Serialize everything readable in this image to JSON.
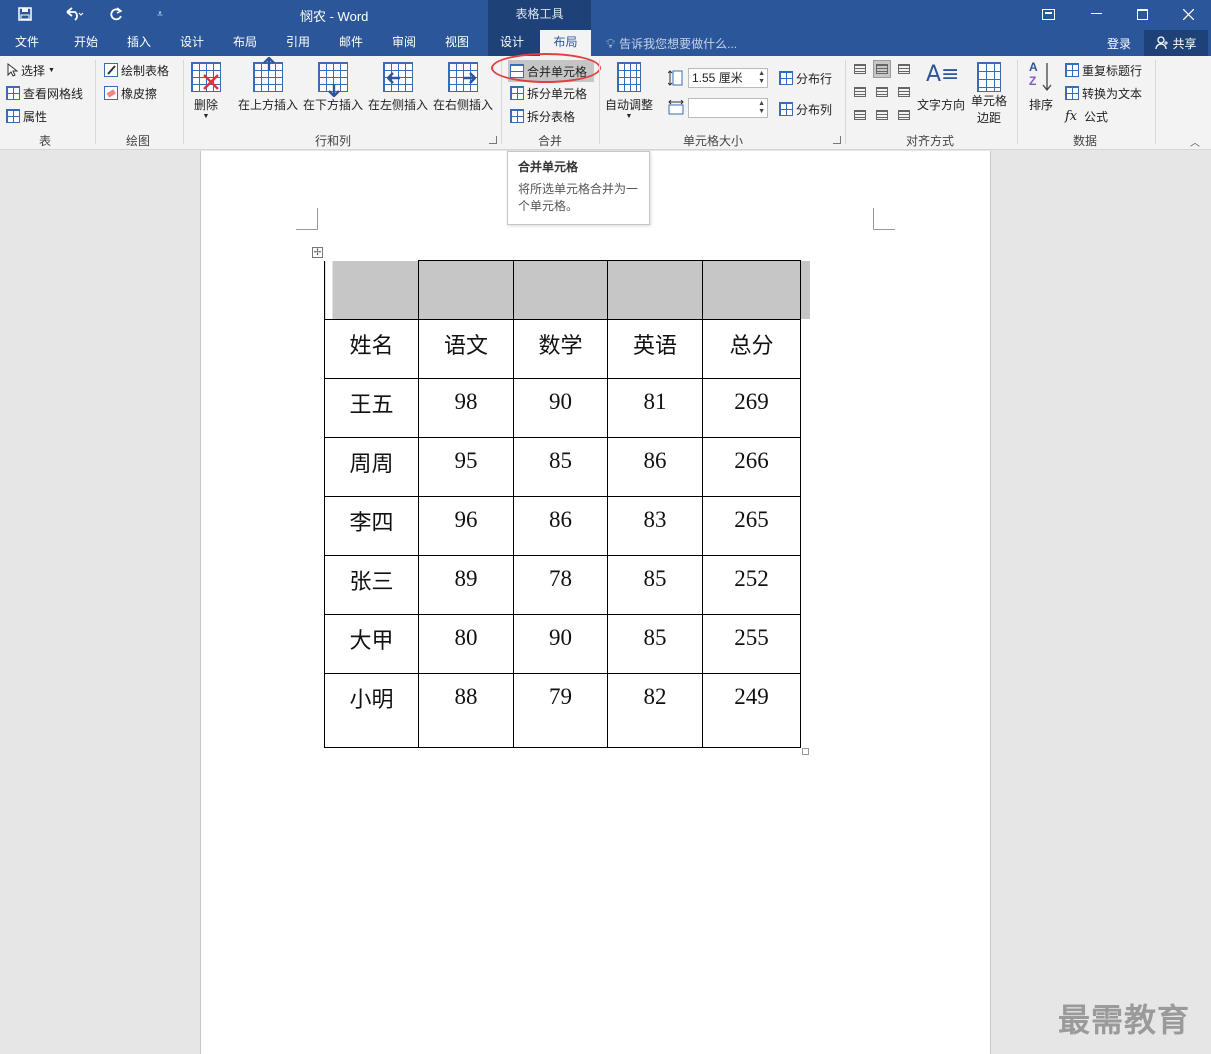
{
  "titlebar": {
    "save_icon": "save-icon",
    "undo_icon": "undo-icon",
    "redo_icon": "redo-icon",
    "customize_icon": "customize-qat-icon",
    "document_title": "悯农 - Word",
    "context_header": "表格工具"
  },
  "tabs": {
    "file": "文件",
    "home": "开始",
    "insert": "插入",
    "design": "设计",
    "layout": "布局",
    "references": "引用",
    "mailings": "邮件",
    "review": "审阅",
    "view": "视图",
    "table_design": "设计",
    "table_layout": "布局",
    "tell_me": "告诉我您想要做什么...",
    "sign_in": "登录",
    "share": "共享"
  },
  "ribbon": {
    "table_group": {
      "label": "表",
      "select": "选择",
      "view_gridlines": "查看网格线",
      "properties": "属性"
    },
    "draw_group": {
      "label": "绘图",
      "draw_table": "绘制表格",
      "eraser": "橡皮擦"
    },
    "rows_cols_group": {
      "label": "行和列",
      "delete": "删除",
      "insert_above": "在上方插入",
      "insert_below": "在下方插入",
      "insert_left": "在左侧插入",
      "insert_right": "在右侧插入"
    },
    "merge_group": {
      "label": "合并",
      "merge_cells": "合并单元格",
      "split_cells": "拆分单元格",
      "split_table": "拆分表格"
    },
    "cell_size_group": {
      "label": "单元格大小",
      "autofit": "自动调整",
      "height_value": "1.55 厘米",
      "width_value": "",
      "distribute_rows": "分布行",
      "distribute_cols": "分布列"
    },
    "alignment_group": {
      "label": "对齐方式",
      "text_direction": "文字方向",
      "cell_margins_line1": "单元格",
      "cell_margins_line2": "边距"
    },
    "data_group": {
      "label": "数据",
      "sort": "排序",
      "repeat_header": "重复标题行",
      "convert_to_text": "转换为文本",
      "formula": "公式"
    }
  },
  "tooltip": {
    "title": "合并单元格",
    "description_line1": "将所选单元格合并为一",
    "description_line2": "个单元格。"
  },
  "table": {
    "header": [
      "姓名",
      "语文",
      "数学",
      "英语",
      "总分"
    ],
    "rows": [
      [
        "王五",
        "98",
        "90",
        "81",
        "269"
      ],
      [
        "周周",
        "95",
        "85",
        "86",
        "266"
      ],
      [
        "李四",
        "96",
        "86",
        "83",
        "265"
      ],
      [
        "张三",
        "89",
        "78",
        "85",
        "252"
      ],
      [
        "大甲",
        "80",
        "90",
        "85",
        "255"
      ],
      [
        "小明",
        "88",
        "79",
        "82",
        "249"
      ]
    ]
  },
  "watermark": "最需教育",
  "colors": {
    "accent": "#2b579a",
    "context_tab": "#1e4278",
    "selection": "#c6c6c6",
    "highlight_oval": "#e24040"
  }
}
